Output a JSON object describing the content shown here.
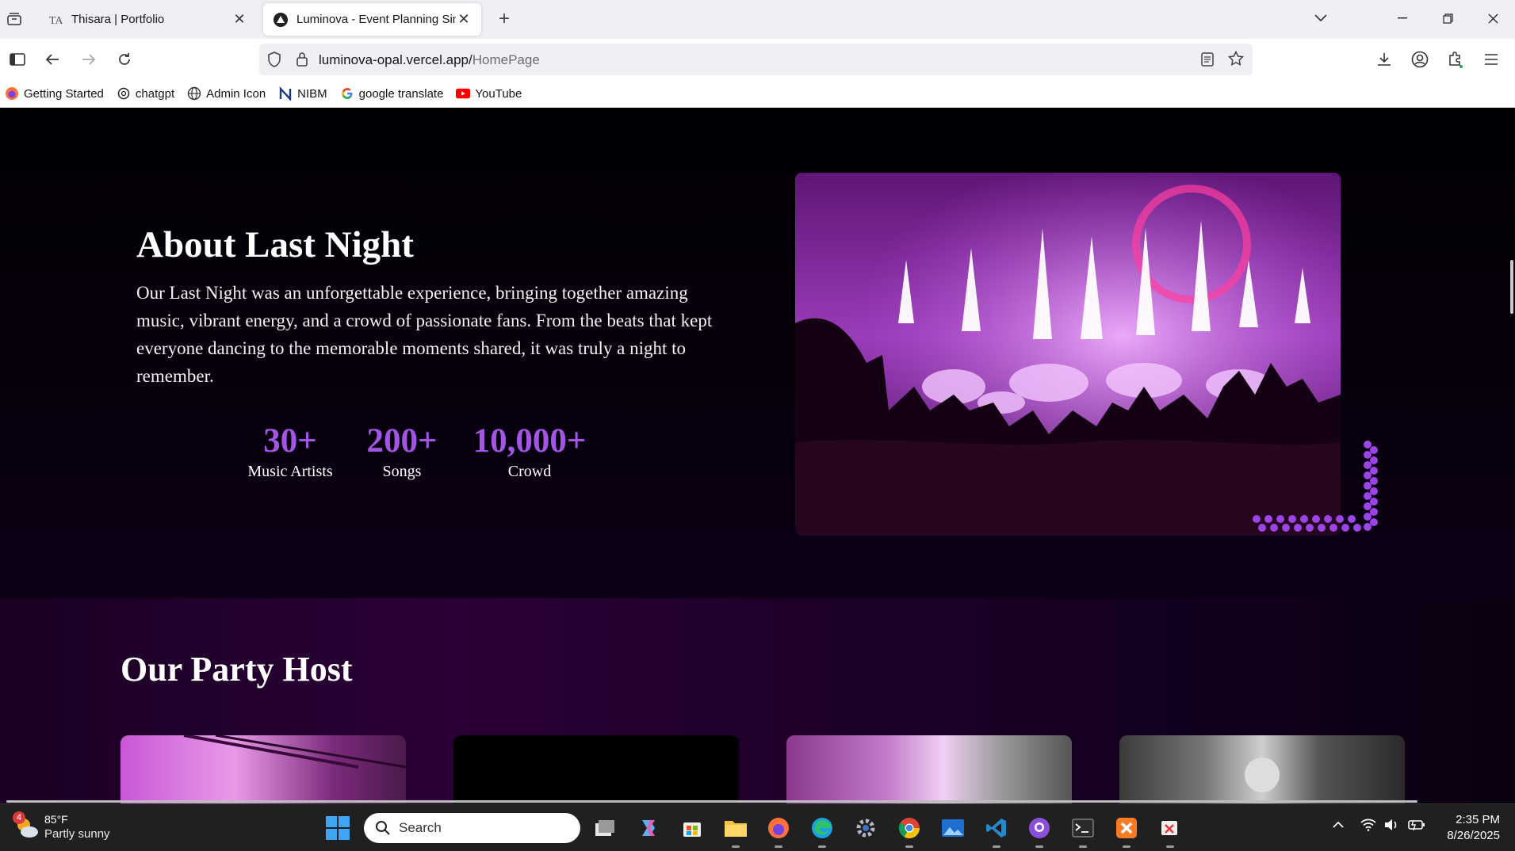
{
  "browser": {
    "tabs": [
      {
        "title": "Thisara | Portfolio",
        "icon": "portfolio-favicon"
      },
      {
        "title": "Luminova - Event Planning Simp",
        "icon": "luminova-favicon"
      }
    ],
    "url_host": "luminova-opal.vercel.app/",
    "url_path": "HomePage",
    "bookmarks": [
      {
        "label": "Getting Started",
        "icon": "firefox-icon"
      },
      {
        "label": "chatgpt",
        "icon": "openai-icon"
      },
      {
        "label": "Admin Icon",
        "icon": "globe-icon"
      },
      {
        "label": "NIBM",
        "icon": "nibm-icon"
      },
      {
        "label": "google translate",
        "icon": "google-icon"
      },
      {
        "label": "YouTube",
        "icon": "youtube-icon"
      }
    ]
  },
  "about": {
    "title": "About Last Night",
    "text": "Our Last Night was an unforgettable experience, bringing together amazing music, vibrant energy, and a crowd of passionate fans. From the beats that kept everyone dancing to the memorable moments shared, it was truly a night to remember.",
    "stats": [
      {
        "value": "30+",
        "label": "Music Artists"
      },
      {
        "value": "200+",
        "label": "Songs"
      },
      {
        "value": "10,000+",
        "label": "Crowd"
      }
    ],
    "accent": "#a356e6"
  },
  "host": {
    "title": "Our Party Host"
  },
  "taskbar": {
    "weather_temp": "85°F",
    "weather_cond": "Partly sunny",
    "weather_badge": "4",
    "search_placeholder": "Search",
    "time": "2:35 PM",
    "date": "8/26/2025"
  }
}
